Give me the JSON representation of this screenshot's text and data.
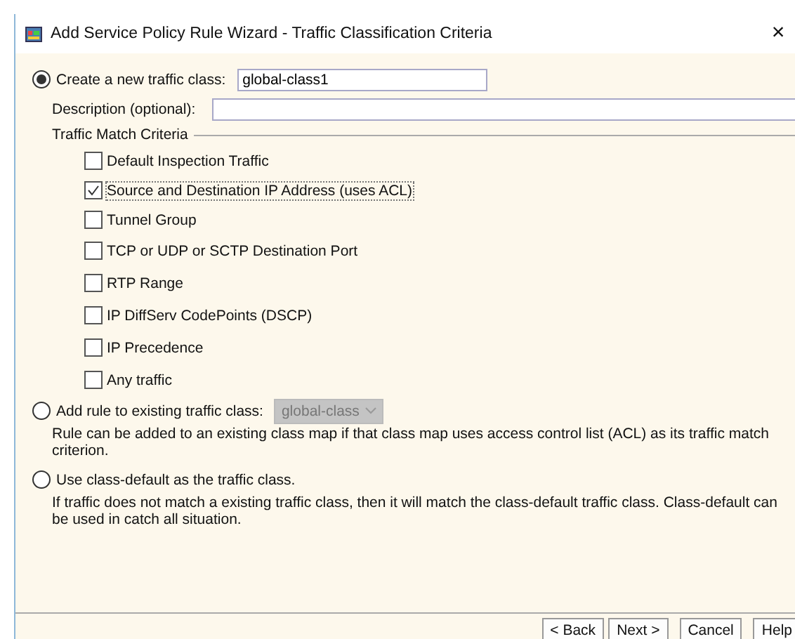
{
  "window": {
    "title": "Add Service Policy Rule Wizard - Traffic Classification Criteria",
    "close": "×"
  },
  "new_class": {
    "label": "Create a new traffic class:",
    "selected": true,
    "value": "global-class1"
  },
  "description": {
    "label": "Description (optional):"
  },
  "criteria": {
    "title": "Traffic Match Criteria",
    "items": [
      {
        "label": "Default Inspection Traffic",
        "checked": false
      },
      {
        "label": "Source and Destination IP Address (uses ACL)",
        "checked": true
      },
      {
        "label": "Tunnel Group",
        "checked": false
      },
      {
        "label": "TCP or UDP or SCTP Destination Port",
        "checked": false
      },
      {
        "label": "RTP Range",
        "checked": false
      },
      {
        "label": "IP DiffServ CodePoints (DSCP)",
        "checked": false
      },
      {
        "label": "IP Precedence",
        "checked": false
      },
      {
        "label": "Any traffic",
        "checked": false
      }
    ]
  },
  "existing_class": {
    "label": "Add rule to existing traffic class:",
    "selected": false,
    "dropdown": {
      "value": "global-class",
      "disabled": true
    },
    "note": "Rule can be added to an existing class map if that class map uses access control list (ACL) as its traffic match criterion."
  },
  "class_default": {
    "label": "Use class-default as the traffic class.",
    "selected": false,
    "note": "If traffic does not match a existing traffic class, then it will match the class-default traffic class. Class-default can be used in catch all situation."
  },
  "buttons": [
    "< Back",
    "Next >",
    "Cancel",
    "Help"
  ]
}
